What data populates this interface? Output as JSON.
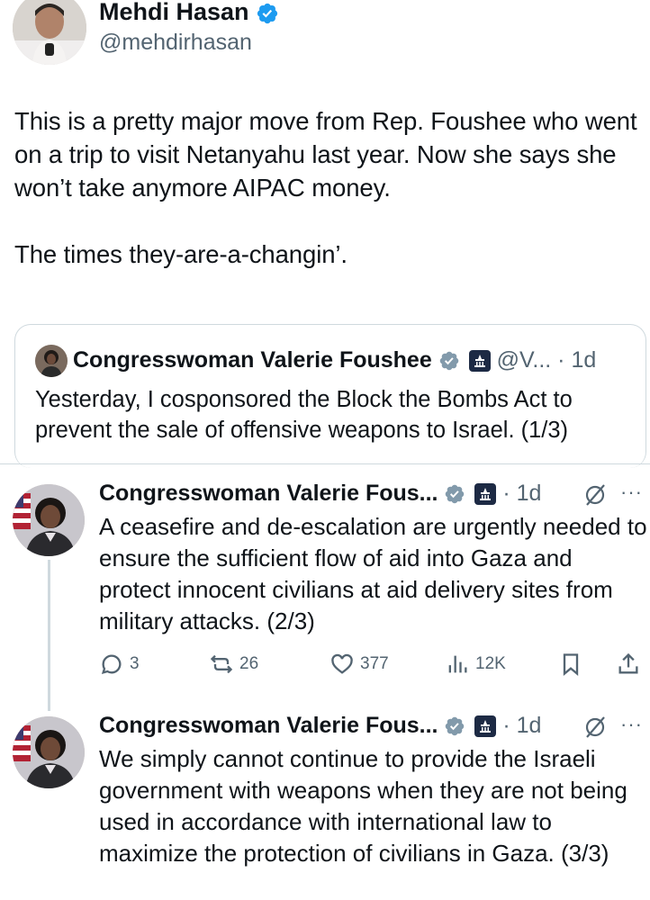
{
  "main_tweet": {
    "author_name": "Mehdi Hasan",
    "author_handle": "@mehdirhasan",
    "text": "This is a pretty major move from Rep. Foushee who went on a trip to visit Netanyahu last year. Now she says she won’t take anymore AIPAC money.\n\nThe times they-are-a-changin’."
  },
  "quoted_tweet": {
    "author_name": "Congresswoman Valerie Foushee",
    "handle_truncated": "@V...",
    "time": "· 1d",
    "text": "Yesterday, I cosponsored the Block the Bombs Act to prevent the sale of offensive weapons to Israel. (1/3)"
  },
  "replies": [
    {
      "author_name": "Congresswoman Valerie Fous...",
      "time": "· 1d",
      "more": "···",
      "text": "A ceasefire and de-escalation are urgently needed to ensure the sufficient flow of aid into Gaza and protect innocent civilians at aid delivery sites from military attacks. (2/3)",
      "actions": {
        "replies": "3",
        "retweets": "26",
        "likes": "377",
        "views": "12K"
      }
    },
    {
      "author_name": "Congresswoman Valerie Fous...",
      "time": "· 1d",
      "more": "···",
      "text": "We simply cannot continue to provide the Israeli government with weapons when they are not being used in accordance with international law to maximize the protection of civilians in Gaza. (3/3)"
    }
  ],
  "colors": {
    "verified": "#1d9bf0",
    "gov_badge": "#1d2a44",
    "muted": "#536471",
    "border": "#cfd9de"
  },
  "icons": [
    "verified-badge-icon",
    "government-badge-icon",
    "grok-icon",
    "more-icon",
    "reply-icon",
    "retweet-icon",
    "like-icon",
    "views-icon",
    "bookmark-icon",
    "share-icon"
  ]
}
